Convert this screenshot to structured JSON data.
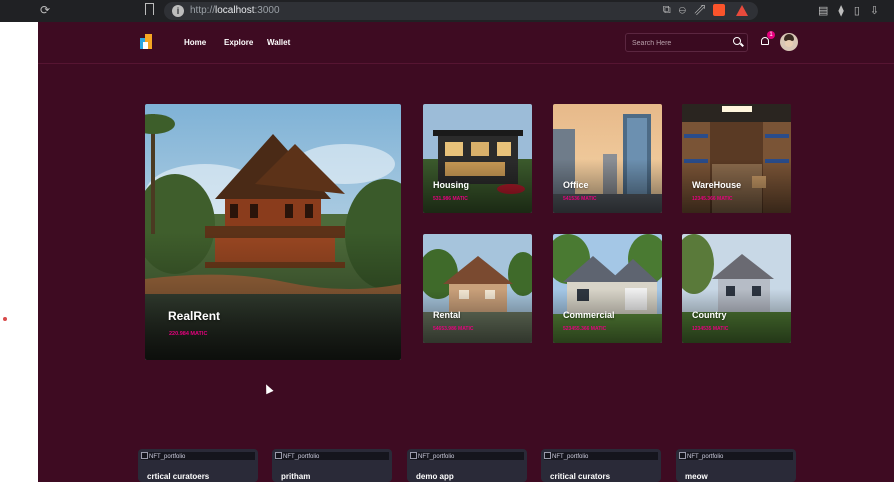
{
  "browser": {
    "url_prefix": "http://",
    "url_host": "localhost",
    "url_port": ":3000"
  },
  "nav": {
    "links": [
      "Home",
      "Explore",
      "Wallet"
    ],
    "search_placeholder": "Search Here",
    "notification_count": "1"
  },
  "categories": [
    {
      "title": "RealRent",
      "price": "220.984 MATIC"
    },
    {
      "title": "Housing",
      "price": "531.986 MATIC"
    },
    {
      "title": "Office",
      "price": "541536 MATIC"
    },
    {
      "title": "WareHouse",
      "price": "12345.366 MATIC"
    },
    {
      "title": "Rental",
      "price": "54653.986 MATIC"
    },
    {
      "title": "Commercial",
      "price": "523455.366 MATIC"
    },
    {
      "title": "Country",
      "price": "1234535 MATIC"
    }
  ],
  "nft_cards": [
    {
      "alt": "NFT_portfolio",
      "name": "crtical curatoers"
    },
    {
      "alt": "NFT_portfolio",
      "name": "pritham"
    },
    {
      "alt": "NFT_portfolio",
      "name": "demo app"
    },
    {
      "alt": "NFT_portfolio",
      "name": "critical curators"
    },
    {
      "alt": "NFT_portfolio",
      "name": "meow"
    }
  ],
  "colors": {
    "app_background": "#3e0b22",
    "accent": "#e6007e",
    "card_dark": "#2a2a38"
  }
}
